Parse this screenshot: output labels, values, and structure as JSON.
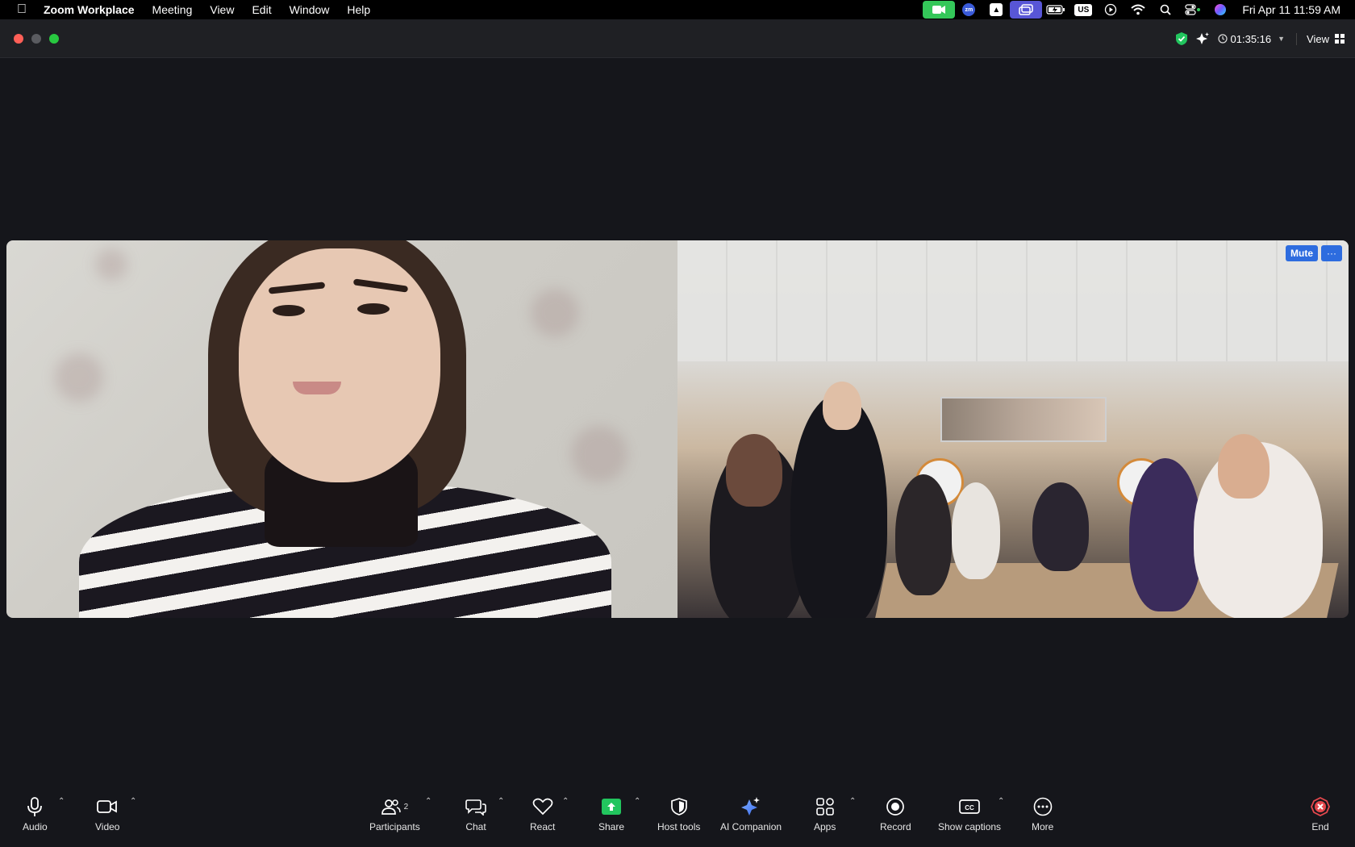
{
  "menubar": {
    "app_name": "Zoom Workplace",
    "menus": [
      "Meeting",
      "View",
      "Edit",
      "Window",
      "Help"
    ],
    "status_icons": [
      "zoom-video-icon",
      "zoom-mini-icon",
      "drive-icon",
      "screen-share-icon",
      "battery-icon",
      "input-source-icon",
      "play-icon",
      "wifi-icon",
      "spotlight-icon",
      "control-center-icon",
      "siri-icon"
    ],
    "input_source": "US",
    "zoom_label": "zm",
    "clock": "Fri Apr 11  11:59 AM"
  },
  "titlebar": {
    "elapsed": "01:35:16",
    "view_label": "View"
  },
  "tiles": {
    "remote": {
      "mute_label": "Mute",
      "more_label": "···"
    }
  },
  "toolbar": {
    "audio": "Audio",
    "video": "Video",
    "participants": "Participants",
    "participant_count": "2",
    "chat": "Chat",
    "react": "React",
    "share": "Share",
    "host_tools": "Host tools",
    "ai_companion": "AI Companion",
    "apps": "Apps",
    "record": "Record",
    "show_captions": "Show captions",
    "more": "More",
    "end": "End"
  },
  "colors": {
    "accent_blue": "#2d6cdf",
    "share_green": "#22c55e",
    "end_red": "#e5484d",
    "background": "#15161b"
  }
}
